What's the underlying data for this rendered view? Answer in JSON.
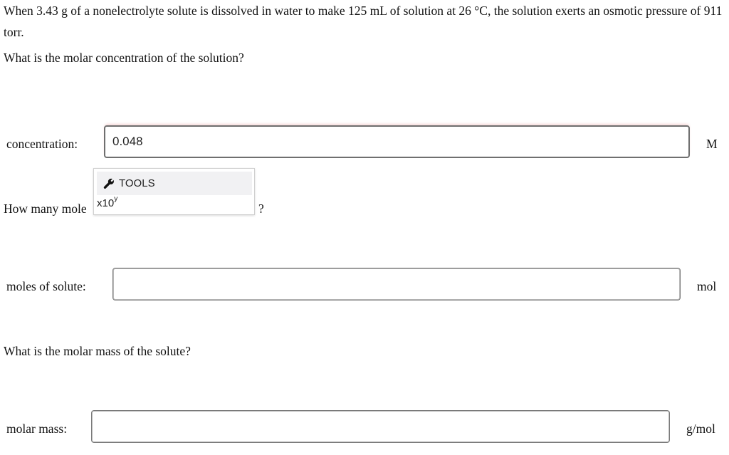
{
  "question": {
    "intro": "When 3.43 g of a nonelectrolyte solute is dissolved in water to make 125 mL of solution at 26 °C, the solution exerts an osmotic pressure of 911 torr.",
    "concentration_question": "What is the molar concentration of the solution?",
    "moles_question_head": "How many mole",
    "moles_question_tail": "?",
    "molar_mass_question": "What is the molar mass of the solute?"
  },
  "fields": {
    "concentration": {
      "label": "concentration:",
      "value": "0.048",
      "unit": "M"
    },
    "moles": {
      "label": "moles of solute:",
      "value": "",
      "unit": "mol"
    },
    "molar_mass": {
      "label": "molar mass:",
      "value": "",
      "unit": "g/mol"
    }
  },
  "tools_popup": {
    "header": "TOOLS",
    "x10_base": "x10",
    "x10_exp": "y"
  },
  "colors": {
    "active_glow": "#f3c6c6",
    "border": "#7a7a7a"
  }
}
